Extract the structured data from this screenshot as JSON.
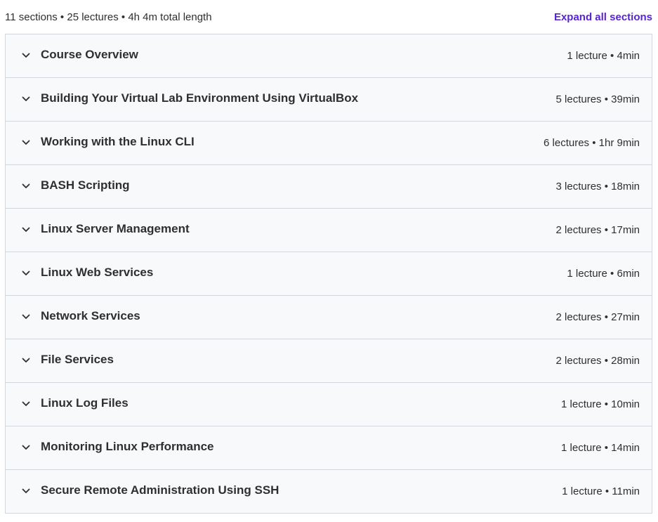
{
  "summary": {
    "text": "11 sections • 25 lectures • 4h 4m total length",
    "expand_label": "Expand all sections"
  },
  "icons": {
    "chevron": "chevron-down-icon"
  },
  "colors": {
    "accent": "#5624d0",
    "row_background": "#f7f9fa",
    "border": "#d1d7dc",
    "text": "#2d2f31"
  },
  "sections": [
    {
      "title": "Course Overview",
      "meta": "1 lecture • 4min"
    },
    {
      "title": "Building Your Virtual Lab Environment Using VirtualBox",
      "meta": "5 lectures • 39min"
    },
    {
      "title": "Working with the Linux CLI",
      "meta": "6 lectures • 1hr 9min"
    },
    {
      "title": "BASH Scripting",
      "meta": "3 lectures • 18min"
    },
    {
      "title": "Linux Server Management",
      "meta": "2 lectures • 17min"
    },
    {
      "title": "Linux Web Services",
      "meta": "1 lecture • 6min"
    },
    {
      "title": "Network Services",
      "meta": "2 lectures • 27min"
    },
    {
      "title": "File Services",
      "meta": "2 lectures • 28min"
    },
    {
      "title": "Linux Log Files",
      "meta": "1 lecture • 10min"
    },
    {
      "title": "Monitoring Linux Performance",
      "meta": "1 lecture • 14min"
    },
    {
      "title": "Secure Remote Administration Using SSH",
      "meta": "1 lecture • 11min"
    }
  ]
}
